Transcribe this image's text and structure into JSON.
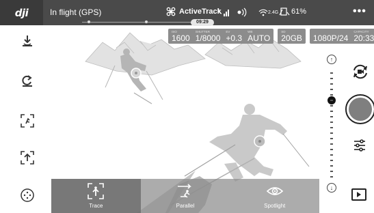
{
  "topbar": {
    "brand": "dji",
    "flight_status": "In flight (GPS)",
    "mode": "ActiveTrack",
    "wifi_band": "2.4G",
    "battery": "61%",
    "more": "•••",
    "record_time": "09:29"
  },
  "camera": {
    "params": [
      {
        "key": "ISO",
        "value": "1600"
      },
      {
        "key": "SHUTTER",
        "value": "1/8000"
      },
      {
        "key": "EV",
        "value": "+0.3"
      },
      {
        "key": "WB",
        "value": "AUTO"
      }
    ],
    "storage": {
      "key": "SD",
      "value": "20GB"
    },
    "video": [
      {
        "key": "",
        "value": "1080P/24"
      },
      {
        "key": "CAPACITY",
        "value": "20:33"
      }
    ]
  },
  "exposure": {
    "top_symbol": "↑",
    "bottom_symbol": "↓",
    "position": 0.33
  },
  "track_modes": [
    {
      "label": "Trace",
      "icon": "trace-icon",
      "selected": true
    },
    {
      "label": "Parallel",
      "icon": "parallel-icon",
      "selected": false
    },
    {
      "label": "Spotlight",
      "icon": "eye-icon",
      "selected": false
    }
  ],
  "colors": {
    "topbar": "#4a4a4a",
    "menu": "#8c8c8c",
    "accent": "#111111"
  }
}
